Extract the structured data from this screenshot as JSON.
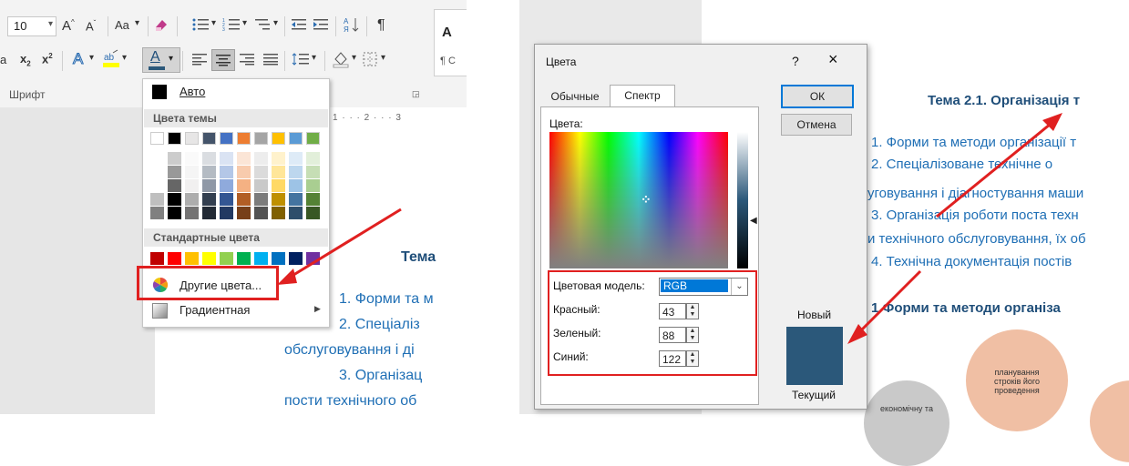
{
  "left_panel": {
    "font_size_value": "10",
    "aa_label": "Aa",
    "group_label": "Шрифт",
    "ruler_text": "1 · · · 2 · · · 3",
    "doc": {
      "heading_fragment": "Тема",
      "item1": "1. Форми та м",
      "item2": "2.   Спеціаліз",
      "item2_cont": "обслуговування і ді",
      "item3": "3. Організац",
      "item3_cont": "пости технічного об"
    },
    "dropdown": {
      "auto_label": "Авто",
      "theme_header": "Цвета темы",
      "standard_header": "Стандартные цвета",
      "other_colors_label": "Другие цвета...",
      "gradient_label": "Градиентная",
      "theme_colors": [
        "#ffffff",
        "#000000",
        "#e7e6e6",
        "#44546a",
        "#4472c4",
        "#ed7d31",
        "#a5a5a5",
        "#ffc000",
        "#5b9bd5",
        "#70ad47"
      ],
      "standard_colors": [
        "#c00000",
        "#ff0000",
        "#ffc000",
        "#ffff00",
        "#92d050",
        "#00b050",
        "#00b0f0",
        "#0070c0",
        "#002060",
        "#7030a0"
      ]
    }
  },
  "color_dialog": {
    "title": "Цвета",
    "help_icon": "?",
    "close_icon": "×",
    "tab_standard": "Обычные",
    "tab_custom": "Спектр",
    "colors_label": "Цвета:",
    "ok_label": "ОК",
    "cancel_label": "Отмена",
    "color_model_label": "Цветовая модель:",
    "color_model_value": "RGB",
    "red_label": "Красный:",
    "red_value": "43",
    "green_label": "Зеленый:",
    "green_value": "88",
    "blue_label": "Синий:",
    "blue_value": "122",
    "new_label": "Новый",
    "current_label": "Текущий",
    "preview_color": "#2b587a"
  },
  "right_doc": {
    "title": "Тема 2.1. Організація т",
    "line1": "1. Форми та методи організації т",
    "line2": "2.  Спеціалізоване  технічне  о",
    "line3": "уговування і діагностування маши",
    "line4": "3. Організація роботи поста техн",
    "line5": "и технічного обслуговування, їх об",
    "line6": "4. Технічна документація постів",
    "heading": "1  Форми та методи організа",
    "bubble1": "планування строків його проведення",
    "bubble2": "економічну та"
  }
}
